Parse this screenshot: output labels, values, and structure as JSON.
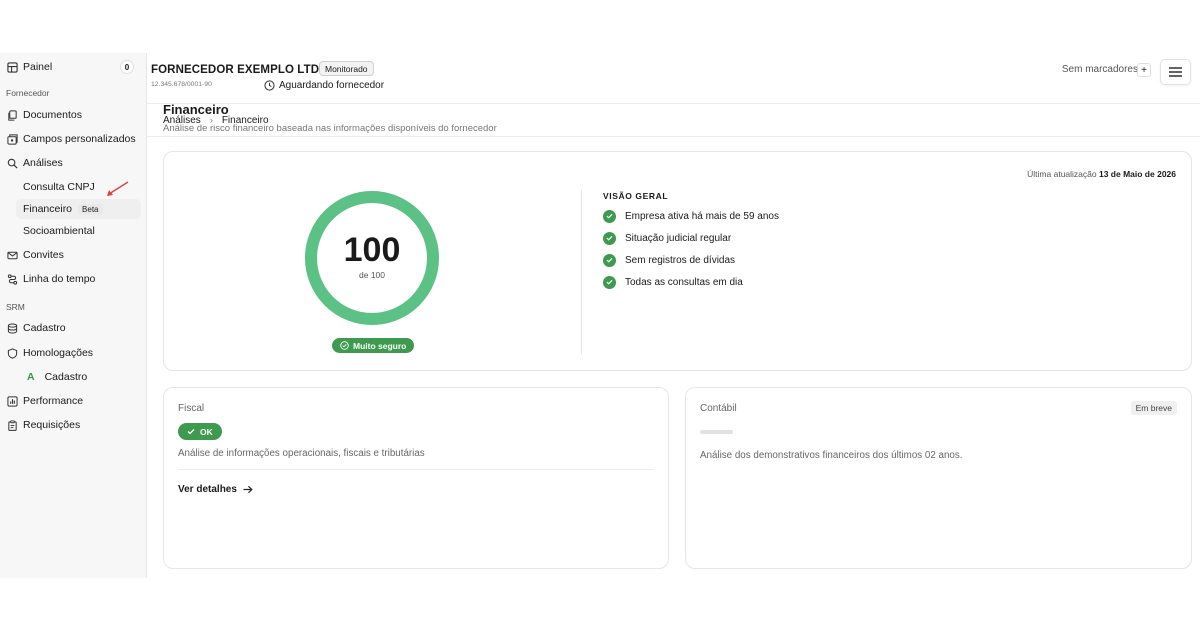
{
  "sidebar": {
    "painel": {
      "label": "Painel",
      "count": "0"
    },
    "section_fornecedor": "Fornecedor",
    "documentos": "Documentos",
    "campos": "Campos personalizados",
    "analises": "Análises",
    "consulta_cnpj": "Consulta CNPJ",
    "financeiro": {
      "label": "Financeiro",
      "badge": "Beta"
    },
    "socioambiental": "Socioambiental",
    "convites": "Convites",
    "linha": "Linha do tempo",
    "section_srm": "SRM",
    "cadastro": "Cadastro",
    "homologacoes": "Homologações",
    "homolog_cadastro": {
      "letter": "A",
      "label": "Cadastro"
    },
    "performance": "Performance",
    "requisicoes": "Requisições"
  },
  "header": {
    "company": "FORNECEDOR EXEMPLO LTDA",
    "status_badge": "Monitorado",
    "cnpj": "12.345.678/0001-90",
    "waiting": "Aguardando fornecedor",
    "markers": "Sem marcadores",
    "plus": "+"
  },
  "breadcrumb": {
    "parent": "Análises",
    "sep": "›",
    "current": "Financeiro"
  },
  "page": {
    "title": "Financeiro",
    "subtitle": "Análise de risco financeiro baseada nas informações disponíveis do fornecedor"
  },
  "overview": {
    "updated_label": "Última atualização",
    "updated_date": "13 de Maio de 2026",
    "score": "100",
    "score_of": "de 100",
    "score_fraction": 1.0,
    "rating": "Muito seguro",
    "title": "VISÃO GERAL",
    "items": [
      "Empresa ativa há mais de 59 anos",
      "Situação judicial regular",
      "Sem registros de dívidas",
      "Todas as consultas em dia"
    ]
  },
  "fiscal": {
    "label": "Fiscal",
    "status": "OK",
    "description": "Análise de informações operacionais, fiscais e tributárias",
    "link": "Ver detalhes"
  },
  "contabil": {
    "label": "Contábil",
    "badge": "Em breve",
    "description": "Análise dos demonstrativos financeiros dos últimos 02 anos."
  },
  "colors": {
    "accent_green": "#3d9a4e",
    "donut_green": "#5cc184",
    "annotation_red": "#e0403a"
  }
}
